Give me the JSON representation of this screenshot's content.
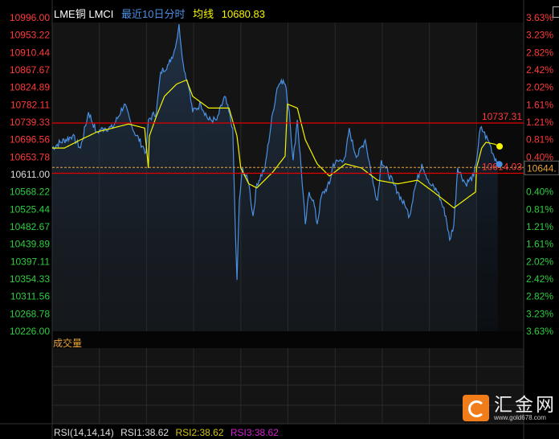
{
  "header": {
    "symbol": "LME铜 LMCI",
    "period": "最近10日分时",
    "avg_label": "均线",
    "avg_value": "10680.83"
  },
  "volume_panel": {
    "label": "成交量"
  },
  "rsi_panel": {
    "name": "RSI(14,14,14)",
    "rsi1": "RSI1:38.62",
    "rsi2": "RSI2:38.62",
    "rsi3": "RSI3:38.62"
  },
  "watermark": {
    "name": "汇金网",
    "url": "www.gold678.com"
  },
  "colors": {
    "up": "#ff3b3b",
    "down": "#2ecc40",
    "price": "#4a90e2",
    "avg": "#f5f500",
    "ref_line": "#e00000"
  },
  "chart_data": {
    "type": "line",
    "title": "LME铜 LMCI 最近10日分时",
    "x_unit": "days",
    "xlim": [
      0,
      10
    ],
    "ylim": [
      10226,
      10996
    ],
    "prev_close": 10611.0,
    "left_ticks": [
      "10996.00",
      "10953.22",
      "10910.44",
      "10867.67",
      "10824.89",
      "10782.11",
      "10739.33",
      "10696.56",
      "10653.78",
      "10611.00",
      "10568.22",
      "10525.44",
      "10482.67",
      "10439.89",
      "10397.11",
      "10354.33",
      "10311.56",
      "10268.78",
      "10226.00"
    ],
    "right_ticks": [
      "3.63%",
      "3.23%",
      "2.82%",
      "2.42%",
      "2.02%",
      "1.61%",
      "1.21%",
      "0.81%",
      "0.40%",
      "",
      "0.40%",
      "0.81%",
      "1.21%",
      "1.61%",
      "2.02%",
      "2.42%",
      "2.82%",
      "3.23%",
      "3.63%"
    ],
    "high_line": {
      "value": 10737.31,
      "label": "10737.31"
    },
    "low_line": {
      "value": 10614.03,
      "label": "10614.03"
    },
    "current": {
      "value": 10644,
      "label": "10644."
    },
    "series": [
      {
        "name": "price",
        "points": [
          [
            0,
            10676
          ],
          [
            0.17,
            10690
          ],
          [
            0.43,
            10705
          ],
          [
            0.6,
            10676
          ],
          [
            0.77,
            10764
          ],
          [
            0.94,
            10715
          ],
          [
            1.11,
            10725
          ],
          [
            1.28,
            10725
          ],
          [
            1.53,
            10784
          ],
          [
            1.7,
            10725
          ],
          [
            1.99,
            10666
          ],
          [
            2.04,
            10745
          ],
          [
            2.21,
            10764
          ],
          [
            2.3,
            10862
          ],
          [
            2.47,
            10882
          ],
          [
            2.61,
            10921
          ],
          [
            2.69,
            10980
          ],
          [
            2.78,
            10882
          ],
          [
            2.9,
            10823
          ],
          [
            2.98,
            10764
          ],
          [
            3.15,
            10784
          ],
          [
            3.32,
            10745
          ],
          [
            3.49,
            10745
          ],
          [
            3.66,
            10803
          ],
          [
            3.83,
            10725
          ],
          [
            3.88,
            10489
          ],
          [
            3.92,
            10352
          ],
          [
            3.97,
            10548
          ],
          [
            4.04,
            10627
          ],
          [
            4.17,
            10588
          ],
          [
            4.26,
            10509
          ],
          [
            4.34,
            10588
          ],
          [
            4.51,
            10627
          ],
          [
            4.68,
            10764
          ],
          [
            4.77,
            10823
          ],
          [
            4.86,
            10843
          ],
          [
            4.94,
            10833
          ],
          [
            5.03,
            10764
          ],
          [
            5.11,
            10646
          ],
          [
            5.2,
            10745
          ],
          [
            5.28,
            10627
          ],
          [
            5.37,
            10489
          ],
          [
            5.45,
            10568
          ],
          [
            5.54,
            10548
          ],
          [
            5.62,
            10489
          ],
          [
            5.71,
            10558
          ],
          [
            5.88,
            10588
          ],
          [
            5.96,
            10637
          ],
          [
            6.13,
            10646
          ],
          [
            6.22,
            10656
          ],
          [
            6.3,
            10725
          ],
          [
            6.39,
            10676
          ],
          [
            6.47,
            10656
          ],
          [
            6.64,
            10696
          ],
          [
            6.81,
            10588
          ],
          [
            6.9,
            10548
          ],
          [
            6.98,
            10646
          ],
          [
            7.07,
            10627
          ],
          [
            7.24,
            10588
          ],
          [
            7.33,
            10568
          ],
          [
            7.5,
            10529
          ],
          [
            7.58,
            10509
          ],
          [
            7.67,
            10568
          ],
          [
            7.84,
            10637
          ],
          [
            8.01,
            10588
          ],
          [
            8.18,
            10568
          ],
          [
            8.35,
            10509
          ],
          [
            8.43,
            10450
          ],
          [
            8.52,
            10489
          ],
          [
            8.6,
            10627
          ],
          [
            8.77,
            10588
          ],
          [
            8.94,
            10607
          ],
          [
            8.99,
            10637
          ],
          [
            9.08,
            10725
          ],
          [
            9.15,
            10715
          ],
          [
            9.28,
            10686
          ],
          [
            9.37,
            10656
          ],
          [
            9.45,
            10642
          ]
        ]
      },
      {
        "name": "average",
        "points": [
          [
            0,
            10676
          ],
          [
            0.26,
            10676
          ],
          [
            0.6,
            10696
          ],
          [
            0.94,
            10715
          ],
          [
            1.28,
            10725
          ],
          [
            1.62,
            10735
          ],
          [
            1.96,
            10725
          ],
          [
            2.04,
            10627
          ],
          [
            2.06,
            10705
          ],
          [
            2.21,
            10754
          ],
          [
            2.38,
            10803
          ],
          [
            2.64,
            10833
          ],
          [
            2.85,
            10843
          ],
          [
            2.98,
            10803
          ],
          [
            3.32,
            10774
          ],
          [
            3.75,
            10774
          ],
          [
            3.92,
            10705
          ],
          [
            4.0,
            10627
          ],
          [
            4.17,
            10588
          ],
          [
            4.34,
            10578
          ],
          [
            4.68,
            10617
          ],
          [
            4.94,
            10656
          ],
          [
            4.99,
            10784
          ],
          [
            5.2,
            10774
          ],
          [
            5.37,
            10696
          ],
          [
            5.62,
            10637
          ],
          [
            5.88,
            10607
          ],
          [
            6.22,
            10637
          ],
          [
            6.56,
            10627
          ],
          [
            6.9,
            10597
          ],
          [
            7.33,
            10588
          ],
          [
            7.75,
            10597
          ],
          [
            8.09,
            10568
          ],
          [
            8.52,
            10529
          ],
          [
            8.86,
            10558
          ],
          [
            8.98,
            10568
          ],
          [
            9.0,
            10627
          ],
          [
            9.11,
            10676
          ],
          [
            9.2,
            10690
          ],
          [
            9.37,
            10686
          ],
          [
            9.49,
            10680
          ]
        ]
      }
    ]
  }
}
